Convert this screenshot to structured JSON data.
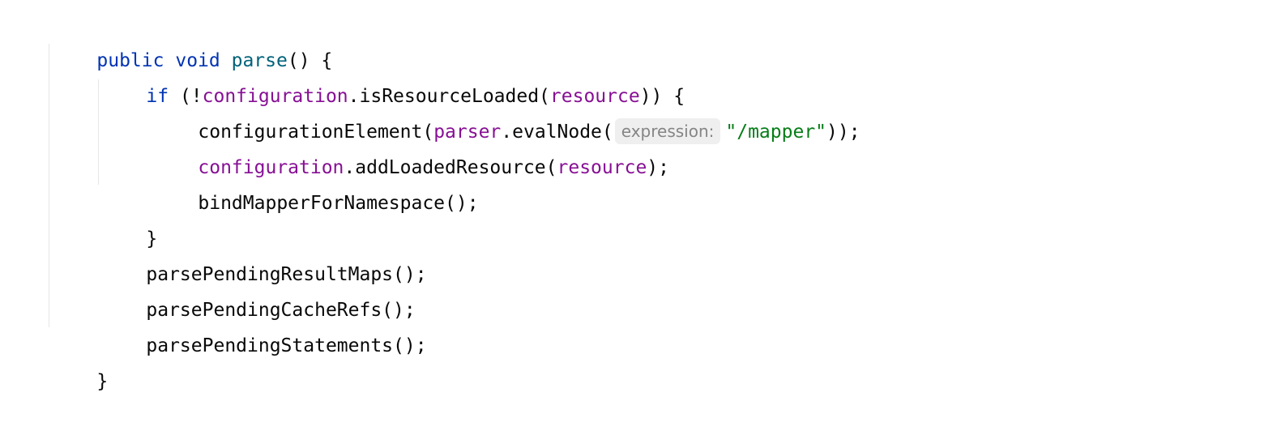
{
  "code": {
    "line1": {
      "kw_public": "public",
      "kw_void": "void",
      "method_name": "parse",
      "tail": "() {"
    },
    "line2": {
      "kw_if": "if",
      "open": " (!",
      "field": "configuration",
      "call": ".isResourceLoaded(",
      "arg": "resource",
      "tail": ")) {"
    },
    "line3": {
      "call": "configurationElement(",
      "field": "parser",
      "call2": ".evalNode(",
      "hint": "expression:",
      "string": "\"/mapper\"",
      "tail": "));"
    },
    "line4": {
      "field": "configuration",
      "call": ".addLoadedResource(",
      "arg": "resource",
      "tail": ");"
    },
    "line5": {
      "text": "bindMapperForNamespace();"
    },
    "line6": {
      "text": "}"
    },
    "line7": {
      "text": "parsePendingResultMaps();"
    },
    "line8": {
      "text": "parsePendingCacheRefs();"
    },
    "line9": {
      "text": "parsePendingStatements();"
    },
    "line10": {
      "text": "}"
    }
  },
  "colors": {
    "keyword": "#0033b3",
    "method_declaration": "#00627a",
    "field": "#871094",
    "string": "#067d17",
    "plain": "#080808",
    "inlay_hint_text": "#858585",
    "inlay_hint_background": "#efefef"
  }
}
